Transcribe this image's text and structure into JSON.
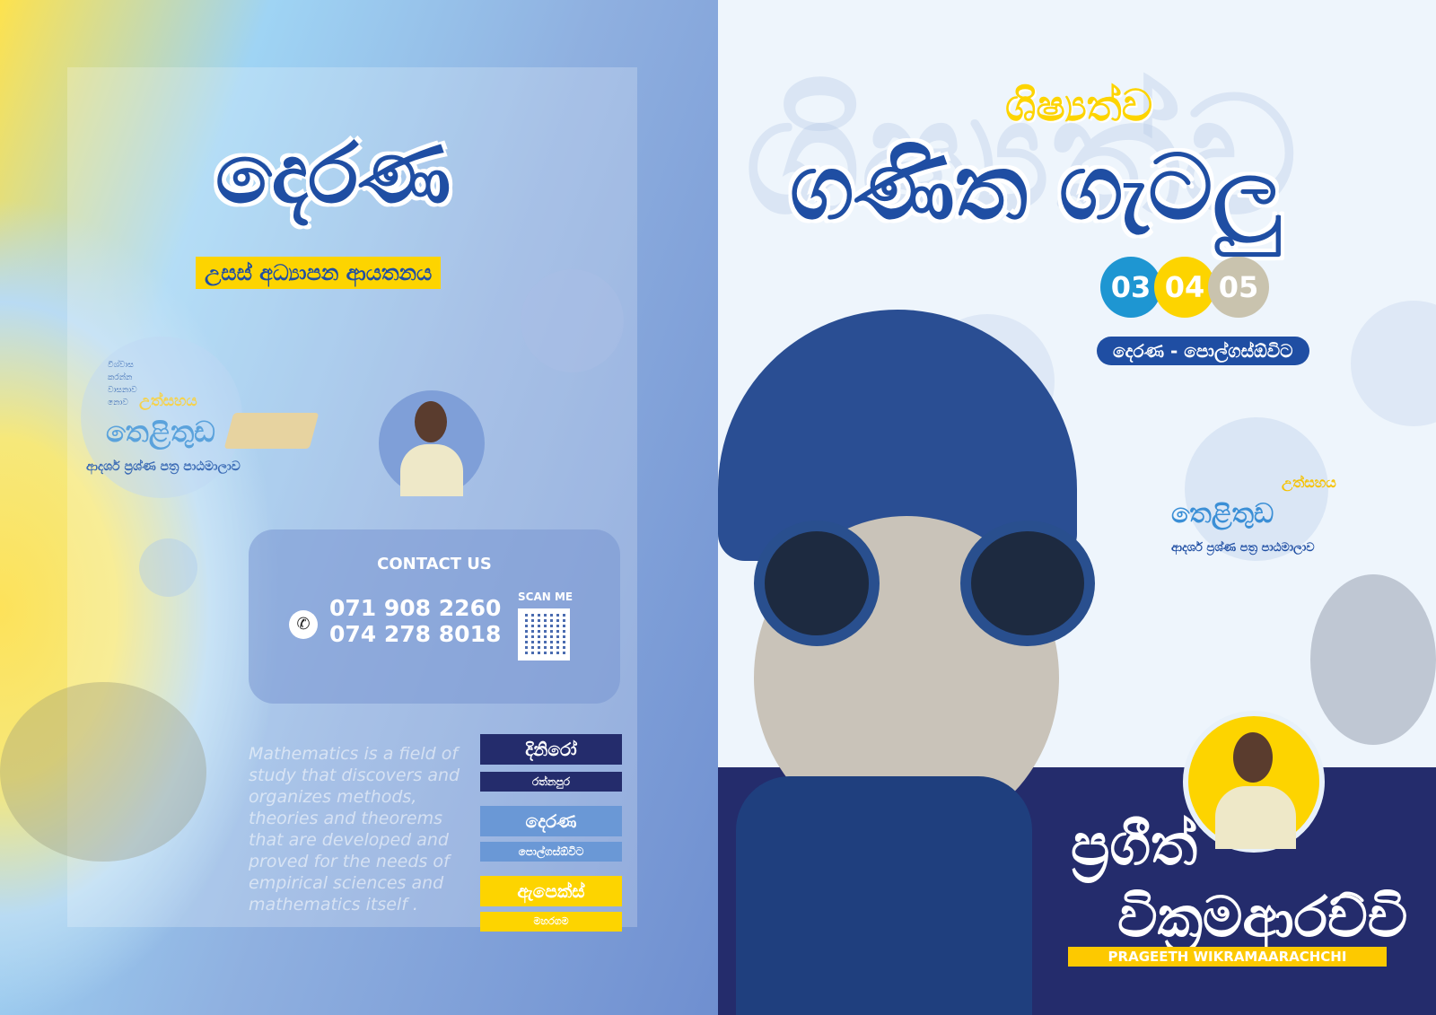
{
  "left": {
    "logo": "දෙරණ",
    "subtitle": "උසස් අධ්‍යාපන ආයතනය",
    "badge": {
      "quote_lines": [
        "විශ්වාස",
        "කරන්න",
        "වාසනාව",
        "නොව"
      ],
      "highlight": "උත්සහය",
      "title": "තෙළිතුඩ",
      "caption": "ආදර්ශ ප්‍රශ්ණ පත්‍ර පාඨමාලාව"
    },
    "contact": {
      "heading": "CONTACT US",
      "scan_label": "SCAN ME",
      "phones": [
        "071 908 2260",
        "074 278 8018"
      ],
      "icon": "whatsapp-icon"
    },
    "quote": "Mathematics is a field of study that discovers and organizes methods, theories and theorems that are developed and proved for the needs of empirical sciences and mathematics itself .",
    "classes": [
      {
        "name": "දිනිරෝ",
        "place": "රත්නපුර",
        "color": "#242c6c"
      },
      {
        "name": "දෙරණ",
        "place": "පොල්ගස්ඕවිට",
        "color": "#6a98d6"
      },
      {
        "name": "ඇපෙක්ස්",
        "place": "මහරගම",
        "color": "#fdd400"
      }
    ]
  },
  "right": {
    "watermark": "ශිෂ්‍යත්ව",
    "title_top": "ශිෂ්‍යත්ව",
    "title_main": "ගණිත ගැටලු",
    "grades": [
      {
        "label": "03",
        "color": "#1e96d2"
      },
      {
        "label": "04",
        "color": "#fdd400"
      },
      {
        "label": "05",
        "color": "#c9c3ae"
      }
    ],
    "location": "දෙරණ - පොල්ගස්ඕවිට",
    "badge": {
      "highlight": "උත්සහය",
      "title": "තෙළිතුඩ",
      "caption": "ආදර්ශ ප්‍රශ්ණ පත්‍ර පාඨමාලාව"
    },
    "teacher": {
      "first": "ප්‍රගීත්",
      "last": "වික්‍රමආරච්චි",
      "english": "PRAGEETH WIKRAMAARACHCHI"
    }
  }
}
